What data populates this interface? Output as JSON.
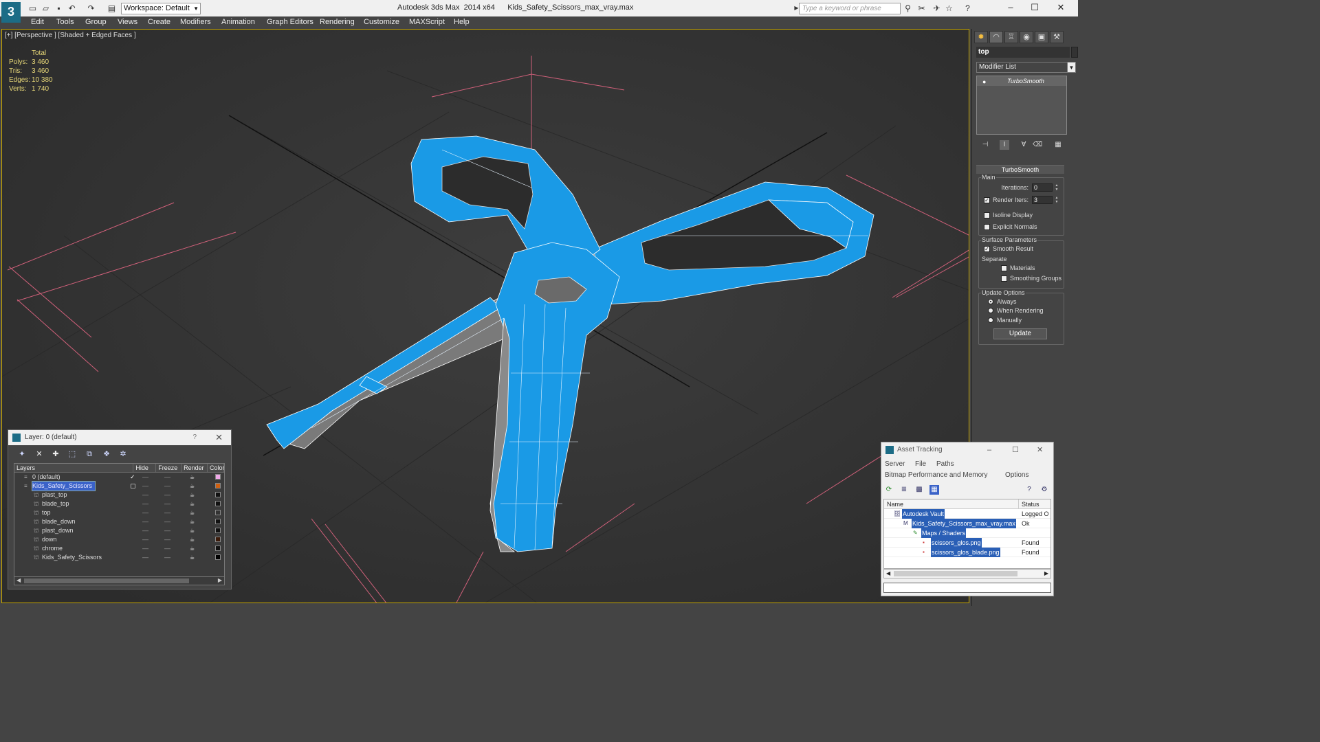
{
  "title_bar": {
    "app_logo": "3",
    "workspace": "Workspace: Default",
    "window_title": "Autodesk 3ds Max  2014 x64      Kids_Safety_Scissors_max_vray.max",
    "search_placeholder": "Type a keyword or phrase",
    "help_label": "?"
  },
  "menu": [
    "Edit",
    "Tools",
    "Group",
    "Views",
    "Create",
    "Modifiers",
    "Animation",
    "Graph Editors",
    "Rendering",
    "Customize",
    "MAXScript",
    "Help"
  ],
  "viewport": {
    "label": "[+] [Perspective ] [Shaded + Edged Faces ]",
    "stats_header": "Total",
    "stats": [
      {
        "key": "Polys:",
        "value": "3 460"
      },
      {
        "key": "Tris:",
        "value": "3 460"
      },
      {
        "key": "Edges:",
        "value": "10 380"
      },
      {
        "key": "Verts:",
        "value": "1 740"
      }
    ],
    "model_color": "#1a9ae6",
    "blade_color": "#7a7a7a"
  },
  "command_panel": {
    "object_name": "top",
    "modifier_list": "Modifier List",
    "stack_entry": "TurboSmooth",
    "rollout_title": "TurboSmooth",
    "main_group": "Main",
    "iterations_label": "Iterations:",
    "iterations_value": "0",
    "render_iters_label": "Render Iters:",
    "render_iters_value": "3",
    "isoline_label": "Isoline Display",
    "explicit_label": "Explicit Normals",
    "surface_group": "Surface Parameters",
    "smooth_label": "Smooth Result",
    "separate_label": "Separate",
    "materials_label": "Materials",
    "smoothing_label": "Smoothing Groups",
    "update_group": "Update Options",
    "always_label": "Always",
    "when_rendering_label": "When Rendering",
    "manually_label": "Manually",
    "update_button": "Update"
  },
  "layer_dialog": {
    "title": "Layer: 0 (default)",
    "help": "?",
    "columns": [
      "Layers",
      "Hide",
      "Freeze",
      "Render",
      "Color"
    ],
    "rows": [
      {
        "name": "0 (default)",
        "indent": 0,
        "color": "#f0a8e8"
      },
      {
        "name": "Kids_Safety_Scissors",
        "indent": 0,
        "color": "#d06010",
        "selected": true
      },
      {
        "name": "plast_top",
        "indent": 1,
        "color": "#111111"
      },
      {
        "name": "blade_top",
        "indent": 1,
        "color": "#111111"
      },
      {
        "name": "top",
        "indent": 1,
        "color": "#333333"
      },
      {
        "name": "blade_down",
        "indent": 1,
        "color": "#111111"
      },
      {
        "name": "plast_down",
        "indent": 1,
        "color": "#111111"
      },
      {
        "name": "down",
        "indent": 1,
        "color": "#3a1a0a"
      },
      {
        "name": "chrome",
        "indent": 1,
        "color": "#111111"
      },
      {
        "name": "Kids_Safety_Scissors",
        "indent": 1,
        "color": "#000000"
      }
    ]
  },
  "asset_dialog": {
    "title": "Asset Tracking",
    "menu_row1": [
      "Server",
      "File",
      "Paths"
    ],
    "menu_row2": [
      "Bitmap Performance and Memory",
      "Options"
    ],
    "columns": [
      "Name",
      "Status"
    ],
    "rows": [
      {
        "name": "Autodesk Vault",
        "status": "Logged O",
        "indent": 0
      },
      {
        "name": "Kids_Safety_Scissors_max_vray.max",
        "status": "Ok",
        "indent": 1
      },
      {
        "name": "Maps / Shaders",
        "status": "",
        "indent": 2
      },
      {
        "name": "scissors_glos.png",
        "status": "Found",
        "indent": 3
      },
      {
        "name": "scissors_glos_blade.png",
        "status": "Found",
        "indent": 3
      }
    ]
  }
}
